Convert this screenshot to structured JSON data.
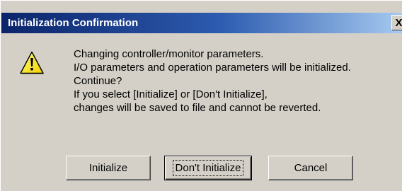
{
  "dialog": {
    "title": "Initialization Confirmation",
    "close_glyph": "X",
    "icon": "warning-icon",
    "message_lines": [
      "Changing controller/monitor parameters.",
      "I/O parameters and operation parameters will be initialized.",
      "Continue?",
      "If you select [Initialize] or [Don't Initialize],",
      "changes will be saved to file and cannot be reverted."
    ],
    "buttons": {
      "initialize": "Initialize",
      "dont_initialize": "Don't Initialize",
      "cancel": "Cancel"
    },
    "focused_button": "dont_initialize"
  },
  "colors": {
    "face": "#d4d0c8",
    "title_start": "#0a246a",
    "title_end": "#a6caf0",
    "warning_fill": "#ffff00",
    "warning_outline": "#000000"
  }
}
